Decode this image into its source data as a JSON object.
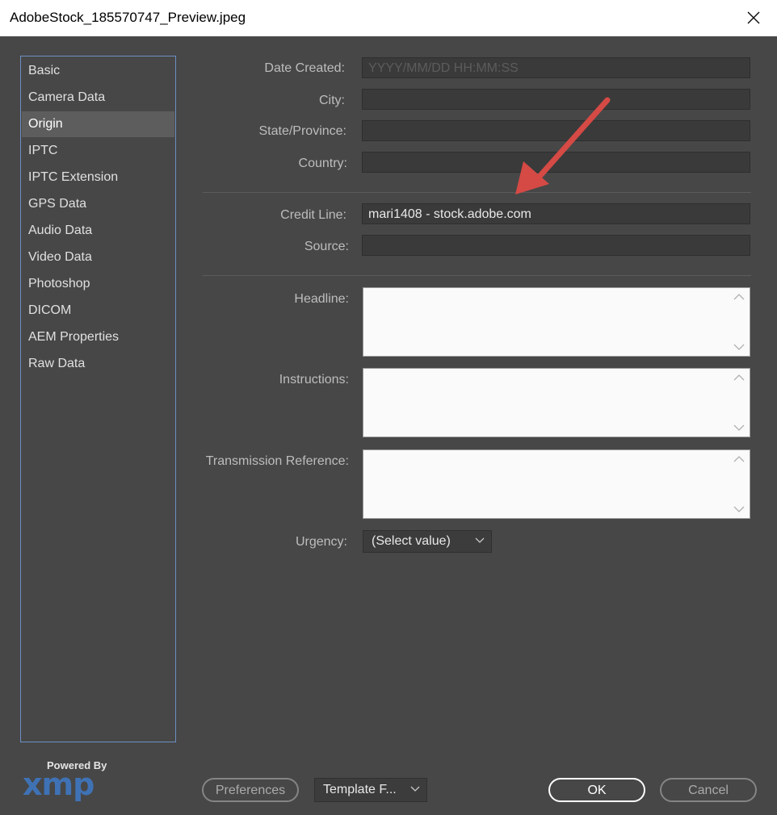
{
  "window": {
    "title": "AdobeStock_185570747_Preview.jpeg"
  },
  "sidebar": {
    "items": [
      {
        "label": "Basic"
      },
      {
        "label": "Camera Data"
      },
      {
        "label": "Origin"
      },
      {
        "label": "IPTC"
      },
      {
        "label": "IPTC Extension"
      },
      {
        "label": "GPS Data"
      },
      {
        "label": "Audio Data"
      },
      {
        "label": "Video Data"
      },
      {
        "label": "Photoshop"
      },
      {
        "label": "DICOM"
      },
      {
        "label": "AEM Properties"
      },
      {
        "label": "Raw Data"
      }
    ],
    "selected": "Origin"
  },
  "form": {
    "date_created": {
      "label": "Date Created:",
      "placeholder": "YYYY/MM/DD HH:MM:SS"
    },
    "city": {
      "label": "City:",
      "value": ""
    },
    "state": {
      "label": "State/Province:",
      "value": ""
    },
    "country": {
      "label": "Country:",
      "value": ""
    },
    "credit_line": {
      "label": "Credit Line:",
      "value": "mari1408 - stock.adobe.com"
    },
    "source": {
      "label": "Source:",
      "value": ""
    },
    "headline": {
      "label": "Headline:",
      "value": ""
    },
    "instructions": {
      "label": "Instructions:",
      "value": ""
    },
    "transmission_reference": {
      "label": "Transmission Reference:",
      "value": ""
    },
    "urgency": {
      "label": "Urgency:",
      "selected": "(Select value)"
    }
  },
  "branding": {
    "powered_by": "Powered By",
    "logo": "xmp"
  },
  "footer": {
    "preferences": "Preferences",
    "template": "Template F...",
    "ok": "OK",
    "cancel": "Cancel"
  },
  "colors": {
    "arrow": "#d54a45",
    "accent": "#3f72b5"
  }
}
